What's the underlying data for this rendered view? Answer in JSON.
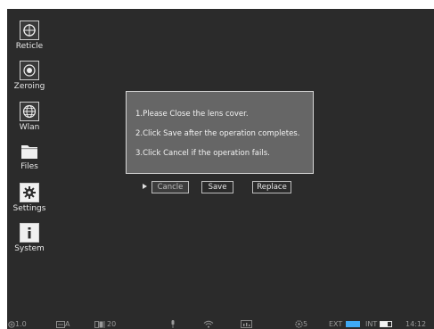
{
  "sidebar": {
    "items": [
      {
        "label": "Reticle",
        "icon": "crosshair-icon"
      },
      {
        "label": "Zeroing",
        "icon": "target-icon"
      },
      {
        "label": "Wlan",
        "icon": "globe-icon"
      },
      {
        "label": "Files",
        "icon": "folder-icon"
      },
      {
        "label": "Settings",
        "icon": "gear-icon"
      },
      {
        "label": "System",
        "icon": "info-icon"
      }
    ]
  },
  "dialog": {
    "lines": [
      "1.Please Close the lens cover.",
      "2.Click Save after the operation completes.",
      "3.Click Cancel if the operation fails."
    ]
  },
  "buttons": {
    "cancel_label": "Cancle",
    "save_label": "Save",
    "replace_label": "Replace"
  },
  "status_bar": {
    "zoom": "1.0",
    "mode": "A",
    "brightness": "20",
    "count": "5",
    "ext_label": "EXT",
    "int_label": "INT",
    "time": "14:12"
  },
  "colors": {
    "screen_bg": "#2b2b2b",
    "dialog_bg": "#666666",
    "ext_indicator": "#3fa9f5"
  }
}
